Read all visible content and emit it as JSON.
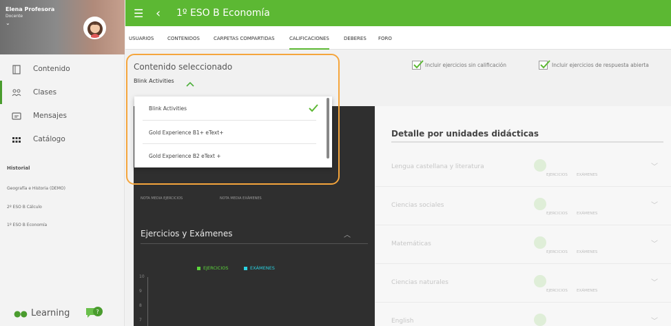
{
  "user": {
    "name": "Elena Profesora",
    "role": "Docente"
  },
  "sidebar": {
    "items": [
      {
        "label": "Contenido",
        "icon": "book-icon"
      },
      {
        "label": "Clases",
        "icon": "people-icon"
      },
      {
        "label": "Mensajes",
        "icon": "message-icon"
      },
      {
        "label": "Catálogo",
        "icon": "grid-icon"
      }
    ],
    "history_title": "Historial",
    "history": [
      "Geografía e Historia (DEMO)",
      "2º ESO B Cálculo",
      "1º ESO B Economía"
    ],
    "brand": "Learning"
  },
  "topbar": {
    "title": "1º ESO B Economía"
  },
  "tabs": [
    "USUARIOS",
    "CONTENIDOS",
    "CARPETAS COMPARTIDAS",
    "CALIFICACIONES",
    "DEBERES",
    "FORO"
  ],
  "content": {
    "heading": "Contenido seleccionado",
    "selected": "Blink Activities",
    "options": [
      "Blink Activities",
      "Gold Experience B1+  eText+",
      "Gold Experience B2  eText +"
    ]
  },
  "filters": {
    "include_ungraded": "Incluir ejercicios sin calificación",
    "include_open": "Incluir ejercicios de respuesta abierta"
  },
  "stats": {
    "avg_exercises": "NOTA MEDIA EJERCICIOS",
    "avg_exams": "NOTA MEDIA EXÁMENES"
  },
  "chart": {
    "title": "Ejercicios y Exámenes",
    "legend": [
      "EJERCICIOS",
      "EXÁMENES"
    ],
    "yticks": [
      "10",
      "9",
      "8",
      "7"
    ]
  },
  "detail": {
    "title": "Detalle por unidades didácticas",
    "col_exercises": "EJERCICIOS",
    "col_exams": "EXÁMENES",
    "units": [
      "Lengua castellana y literatura",
      "Ciencias sociales",
      "Matemáticas",
      "Ciencias naturales",
      "English"
    ]
  },
  "colors": {
    "green": "#5cb833",
    "legend_exercises": "#5cd63c",
    "legend_exams": "#2ad3e3",
    "highlight": "#f5a53c"
  }
}
